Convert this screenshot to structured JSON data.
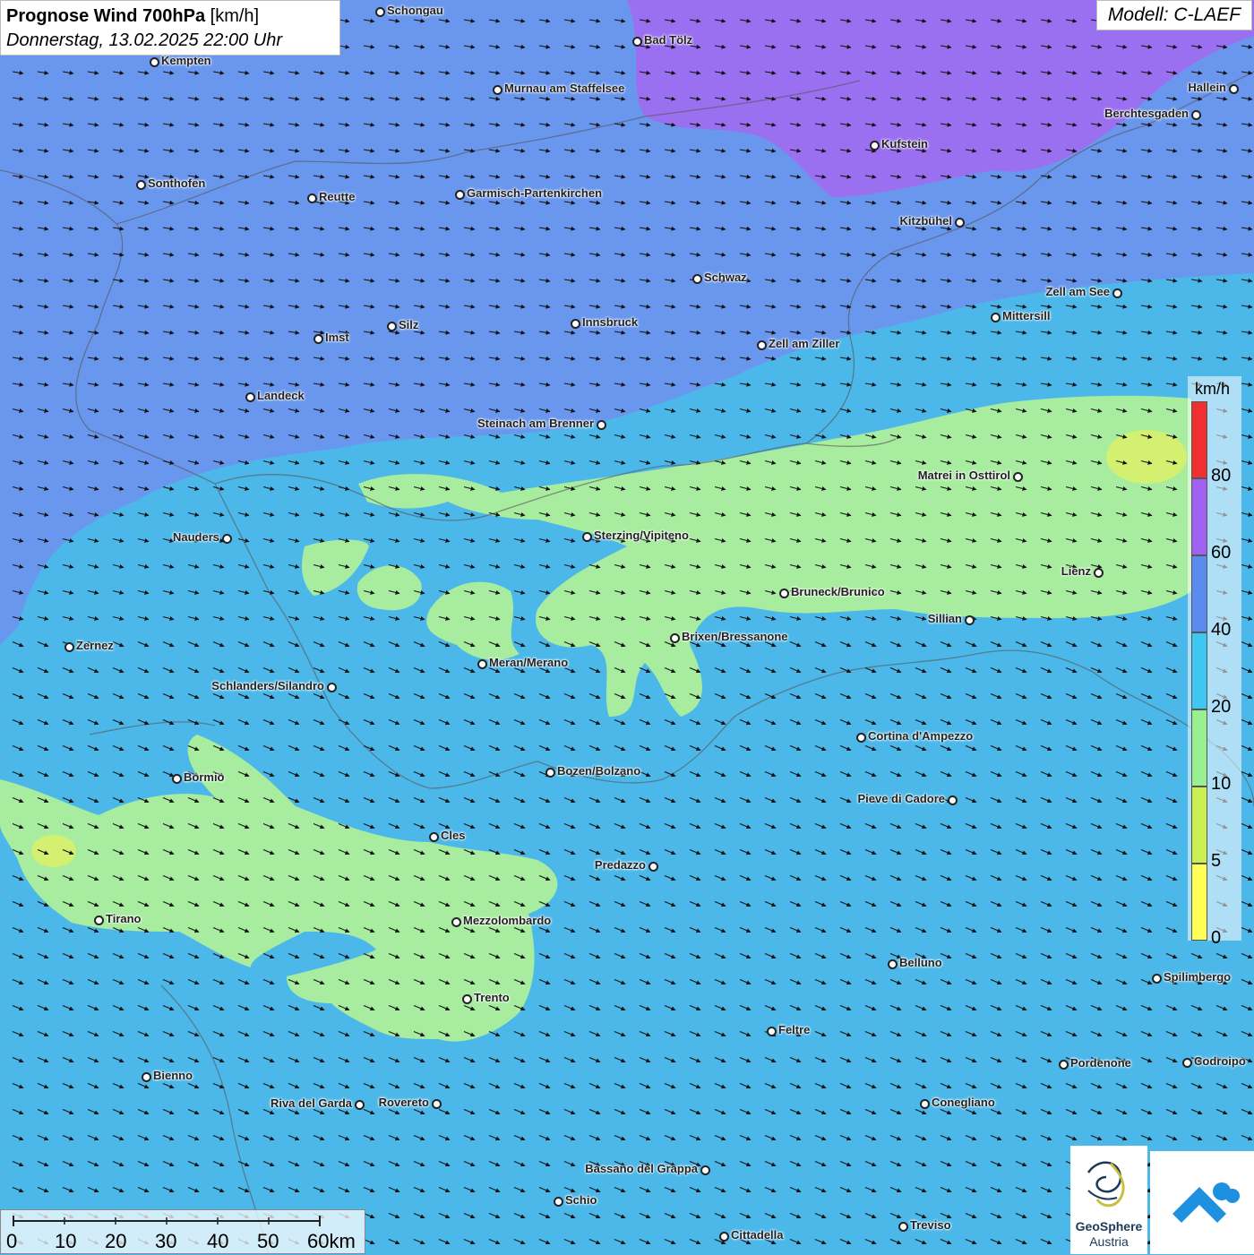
{
  "title": {
    "main": "Prognose Wind 700hPa",
    "unit": " [km/h]",
    "date": "Donnerstag, 13.02.2025 22:00 Uhr"
  },
  "model": "Modell: C-LAEF",
  "legend": {
    "unit": "km/h",
    "labels": [
      "0",
      "5",
      "10",
      "20",
      "40",
      "60",
      "80"
    ],
    "colors": [
      "#ffff55",
      "#c8f050",
      "#98f090",
      "#3cc8f0",
      "#5a8cf0",
      "#a060f0",
      "#f03030"
    ]
  },
  "scale": {
    "labels": [
      "0",
      "10",
      "20",
      "30",
      "40",
      "50",
      "60km"
    ]
  },
  "logos": {
    "geosphere_line1": "GeoSphere",
    "geosphere_line2": "Austria"
  },
  "cities": [
    {
      "name": "Schongau"
    },
    {
      "name": "Bad Tölz"
    },
    {
      "name": "Kempten"
    },
    {
      "name": "Murnau am Staffelsee"
    },
    {
      "name": "Hallein"
    },
    {
      "name": "Berchtesgaden"
    },
    {
      "name": "Kufstein"
    },
    {
      "name": "Sonthofen"
    },
    {
      "name": "Reutte"
    },
    {
      "name": "Garmisch-Partenkirchen"
    },
    {
      "name": "Kitzbühel"
    },
    {
      "name": "Schwaz"
    },
    {
      "name": "Zell am See"
    },
    {
      "name": "Mittersill"
    },
    {
      "name": "Innsbruck"
    },
    {
      "name": "Silz"
    },
    {
      "name": "Imst"
    },
    {
      "name": "Zell am Ziller"
    },
    {
      "name": "Landeck"
    },
    {
      "name": "Steinach am Brenner"
    },
    {
      "name": "Matrei in Osttirol"
    },
    {
      "name": "Nauders"
    },
    {
      "name": "Sterzing/Vipiteno"
    },
    {
      "name": "Lienz"
    },
    {
      "name": "Bruneck/Brunico"
    },
    {
      "name": "Sillian"
    },
    {
      "name": "Brixen/Bressanone"
    },
    {
      "name": "Zernez"
    },
    {
      "name": "Meran/Merano"
    },
    {
      "name": "Schlanders/Silandro"
    },
    {
      "name": "Cortina d'Ampezzo"
    },
    {
      "name": "Bozen/Bolzano"
    },
    {
      "name": "Bormio"
    },
    {
      "name": "Pieve di Cadore"
    },
    {
      "name": "Cles"
    },
    {
      "name": "Predazzo"
    },
    {
      "name": "Tirano"
    },
    {
      "name": "Mezzolombardo"
    },
    {
      "name": "Belluno"
    },
    {
      "name": "Spilimbergo"
    },
    {
      "name": "Trento"
    },
    {
      "name": "Feltre"
    },
    {
      "name": "Pordenone"
    },
    {
      "name": "Codroipo"
    },
    {
      "name": "Bienno"
    },
    {
      "name": "Riva del Garda"
    },
    {
      "name": "Rovereto"
    },
    {
      "name": "Conegliano"
    },
    {
      "name": "Bassano del Grappa"
    },
    {
      "name": "Schio"
    },
    {
      "name": "Treviso"
    },
    {
      "name": "Cittadella"
    }
  ]
}
